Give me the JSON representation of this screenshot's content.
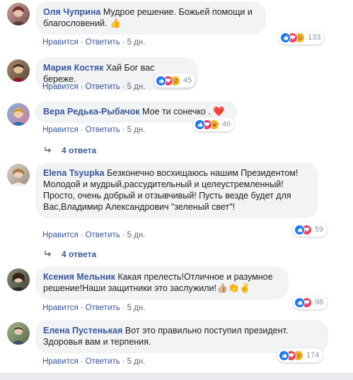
{
  "labels": {
    "like": "Нравится",
    "reply": "Ответить",
    "sep": "·"
  },
  "comments": [
    {
      "author": "Оля Чуприна",
      "text": "Мудрое решение. Божьей помощи и благословений.",
      "emoji": "👍",
      "time": "5 дн.",
      "reactions_count": "133",
      "reaction_icons": [
        "like-icon",
        "love-icon",
        "sad-icon"
      ]
    },
    {
      "author": "Мария Костяк",
      "text": "Хай Бог вас береже.",
      "time": "5 дн.",
      "reactions_count": "45",
      "reaction_icons": [
        "like-icon",
        "love-icon",
        "sad-icon"
      ]
    },
    {
      "author": "Вера Редька-Рыбачок",
      "text": "Мое ти сонечко .",
      "emoji": "❤️",
      "time": "5 дн.",
      "reactions_count": "46",
      "reaction_icons": [
        "like-icon",
        "love-icon",
        "haha-icon"
      ],
      "replies": "4 ответа"
    },
    {
      "author": "Elena Tsyupka",
      "text": "Безконечно восхищаюсь нашим Президентом! Молодой и мудрый,рассудительный и целеустремленный! Просто, очень добрый и отзывчивый! Пусть везде будет для Вас,Владимир Александрович \"зеленый свет\"!",
      "time": "5 дн.",
      "reactions_count": "59",
      "reaction_icons": [
        "like-icon",
        "love-icon"
      ],
      "replies": "4 ответа"
    },
    {
      "author": "Ксения Мельник",
      "text": "Какая прелесть!Отличное и разумное решение!Наши защитники это заслужили!",
      "emoji": "👍🏼👏✌️",
      "time": "5 дн.",
      "reactions_count": "98",
      "reaction_icons": [
        "like-icon",
        "love-icon"
      ]
    },
    {
      "author": "Елена Пустенькая",
      "text": "Вот это правильно поступил президент. Здоровья вам и терпения.",
      "time": "5 дн.",
      "reactions_count": "174",
      "reaction_icons": [
        "like-icon",
        "love-icon",
        "sad-icon"
      ]
    }
  ]
}
